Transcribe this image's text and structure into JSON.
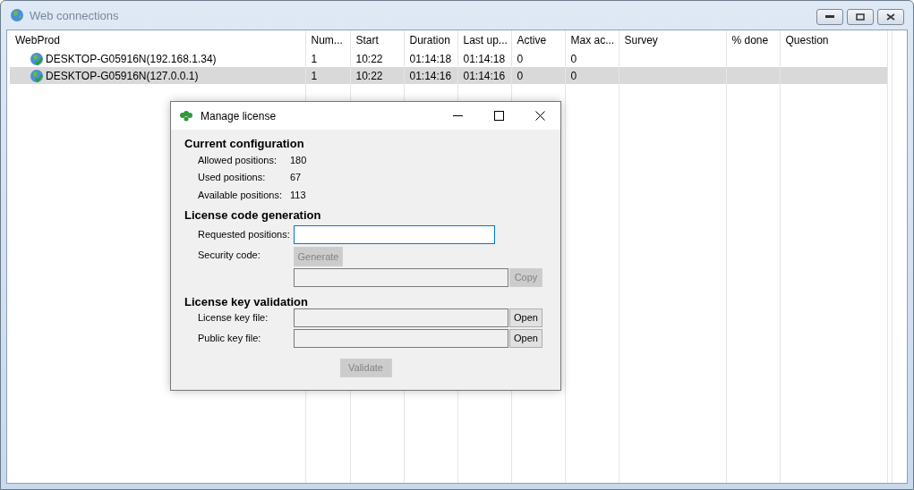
{
  "window": {
    "title": "Web connections"
  },
  "table": {
    "columns": [
      "WebProd",
      "Num...",
      "Start",
      "Duration",
      "Last up...",
      "Active",
      "Max ac...",
      "Survey",
      "% done",
      "Question"
    ],
    "rows": [
      {
        "cells": [
          "DESKTOP-G05916N(192.168.1.34)",
          "1",
          "10:22",
          "01:14:18",
          "01:14:18",
          "0",
          "0"
        ],
        "selected": false
      },
      {
        "cells": [
          "DESKTOP-G05916N(127.0.0.1)",
          "1",
          "10:22",
          "01:14:16",
          "01:14:16",
          "0",
          "0"
        ],
        "selected": true
      }
    ]
  },
  "dialog": {
    "title": "Manage license",
    "configuration": {
      "heading": "Current configuration",
      "items": [
        {
          "label": "Allowed positions:",
          "value": "180"
        },
        {
          "label": "Used positions:",
          "value": "67"
        },
        {
          "label": "Available positions:",
          "value": "113"
        }
      ]
    },
    "generation": {
      "heading": "License code generation",
      "requested_label": "Requested positions:",
      "security_label": "Security code:",
      "generate_button": {
        "label": "Generate",
        "disabled": true
      },
      "copy_button": {
        "label": "Copy",
        "disabled": true
      }
    },
    "validation": {
      "heading": "License key validation",
      "files": [
        {
          "label": "License key file:",
          "button": "Open"
        },
        {
          "label": "Public key file:",
          "button": "Open"
        }
      ]
    },
    "validate_button": {
      "label": "Validate",
      "disabled": true
    }
  }
}
